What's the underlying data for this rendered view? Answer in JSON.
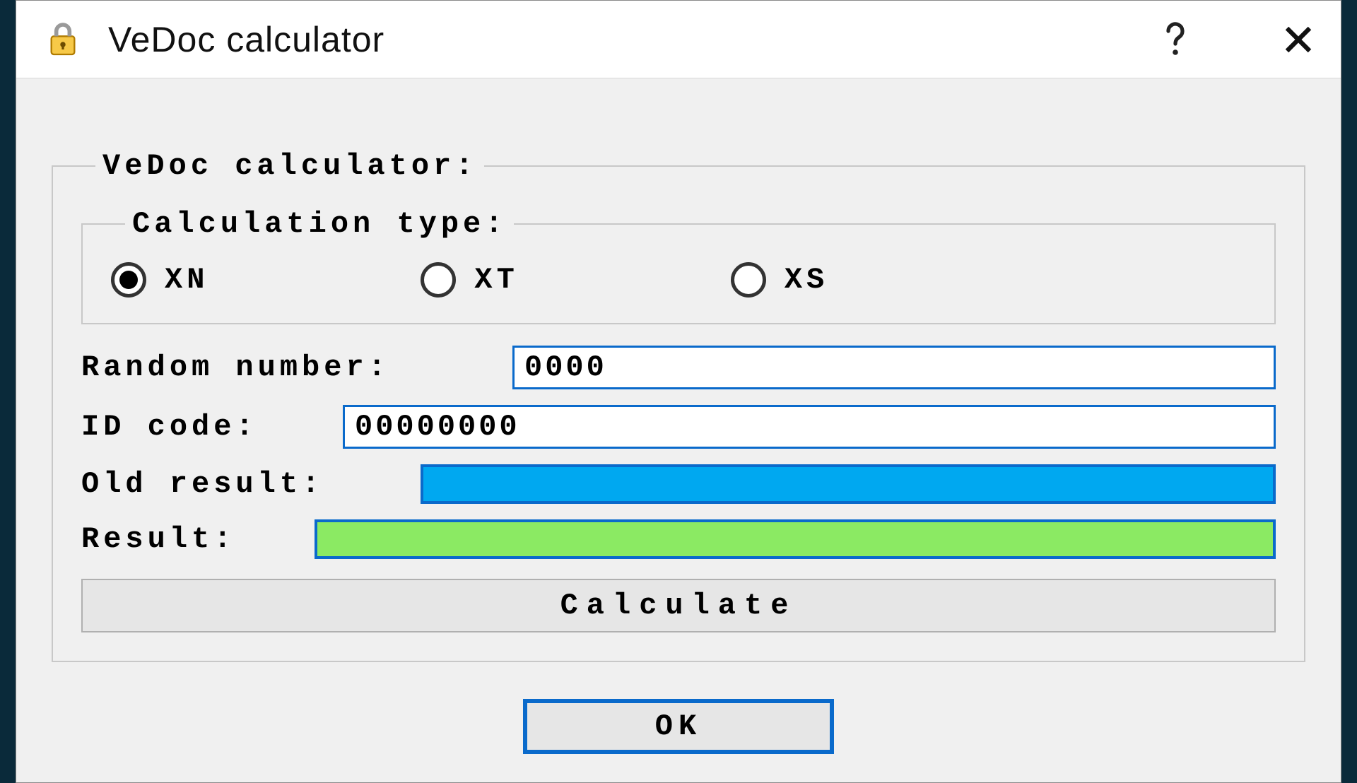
{
  "window": {
    "title": "VeDoc calculator",
    "icon": "lock-icon"
  },
  "group": {
    "title": "VeDoc calculator:",
    "calc_type": {
      "title": "Calculation type:",
      "options": [
        {
          "label": "XN",
          "selected": true
        },
        {
          "label": "XT",
          "selected": false
        },
        {
          "label": "XS",
          "selected": false
        }
      ]
    },
    "fields": {
      "random_label": "Random number:",
      "random_value": "0000",
      "id_label": "ID code:",
      "id_value": "00000000",
      "old_label": "Old result:",
      "old_value": "",
      "result_label": "Result:",
      "result_value": ""
    },
    "buttons": {
      "calculate": "Calculate",
      "ok": "OK"
    }
  },
  "colors": {
    "old_result_bg": "#00a8f0",
    "result_bg": "#8bea63",
    "accent_border": "#0a6acb"
  }
}
